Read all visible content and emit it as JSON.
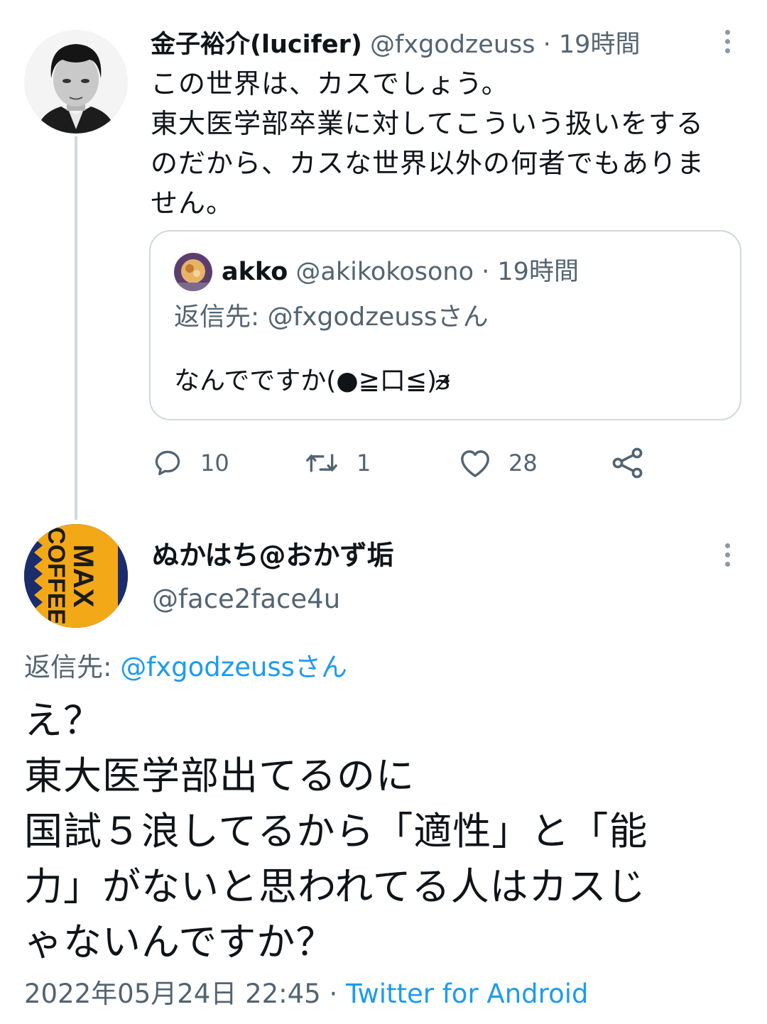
{
  "top_tweet": {
    "display_name": "金子裕介(lucifer)",
    "handle": "@fxgodzeuss",
    "separator": "·",
    "time": "19時間",
    "text_lines": [
      "この世界は、カスでしょう。",
      "東大医学部卒業に対してこういう扱いをする",
      "のだから、カスな世界以外の何者でもありま",
      "せん。"
    ],
    "quote": {
      "display_name": "akko",
      "handle": "@akikokosono",
      "separator": "·",
      "time": "19時間",
      "reply_prefix": "返信先: ",
      "reply_to": "@fxgodzeussさん",
      "text": "なんでですか(●≧口≦)ɜ̴̷"
    },
    "actions": {
      "reply_count": "10",
      "retweet_count": "1",
      "like_count": "28"
    }
  },
  "main_tweet": {
    "display_name": "ぬかはち@おかず垢",
    "handle": "@face2face4u",
    "avatar_text": "MAX COFFEE",
    "reply_prefix": "返信先: ",
    "reply_to": "@fxgodzeussさん",
    "text_lines": [
      "え？",
      "東大医学部出てるのに",
      "国試５浪してるから「適性」と「能",
      "力」がないと思われてる人はカスじ",
      "ゃないんですか？"
    ],
    "timestamp": "2022年05月24日 22:45",
    "separator": "·",
    "source": "Twitter for Android"
  },
  "colors": {
    "accent": "#1d9bf0",
    "muted": "#536471",
    "border": "#cfd9de",
    "like": "#536471"
  },
  "icons": [
    "more-icon",
    "reply-icon",
    "retweet-icon",
    "like-icon",
    "share-icon"
  ]
}
